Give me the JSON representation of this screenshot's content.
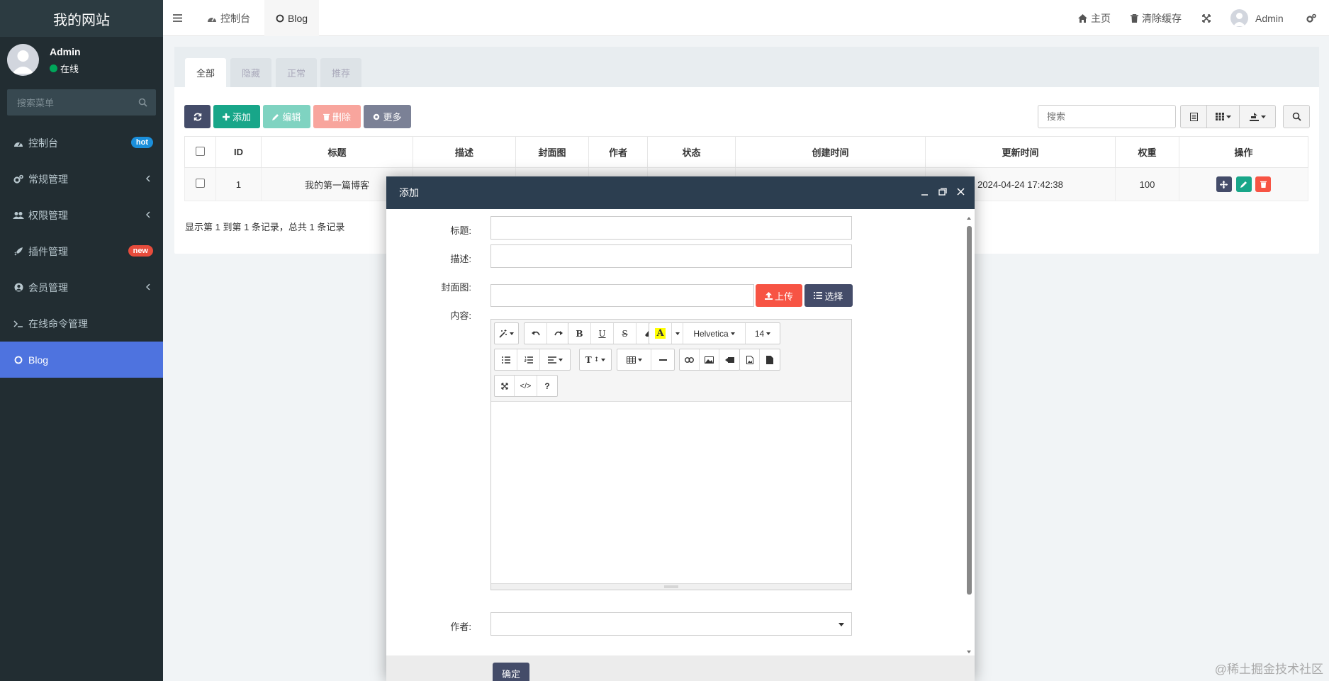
{
  "sidebar": {
    "logo": "我的网站",
    "user": {
      "name": "Admin",
      "status": "在线"
    },
    "search_placeholder": "搜索菜单",
    "items": [
      {
        "label": "控制台",
        "badge": "hot",
        "badge_color": "#1b8fdb",
        "icon": "dashboard-icon"
      },
      {
        "label": "常规管理",
        "icon": "cogs-icon",
        "has_children": true
      },
      {
        "label": "权限管理",
        "icon": "users-icon",
        "has_children": true
      },
      {
        "label": "插件管理",
        "badge": "new",
        "badge_color": "#e74c3c",
        "icon": "rocket-icon"
      },
      {
        "label": "会员管理",
        "icon": "user-circle-icon",
        "has_children": true
      },
      {
        "label": "在线命令管理",
        "icon": "terminal-icon"
      },
      {
        "label": "Blog",
        "icon": "circle-o-icon",
        "active": true
      }
    ]
  },
  "header": {
    "tabs": [
      {
        "label": "控制台",
        "icon": "dashboard-icon"
      },
      {
        "label": "Blog",
        "icon": "circle-o-icon",
        "active": true
      }
    ],
    "home_label": "主页",
    "clear_cache_label": "清除缓存",
    "user_name": "Admin"
  },
  "content": {
    "filter_tabs": [
      "全部",
      "隐藏",
      "正常",
      "推荐"
    ],
    "toolbar": {
      "add": "添加",
      "edit": "编辑",
      "delete": "删除",
      "more": "更多",
      "search_placeholder": "搜索"
    },
    "table": {
      "columns": [
        "ID",
        "标题",
        "描述",
        "封面图",
        "作者",
        "状态",
        "创建时间",
        "更新时间",
        "权重",
        "操作"
      ],
      "rows": [
        {
          "id": "1",
          "title": "我的第一篇博客",
          "updated": "2024-04-24 17:42:38",
          "weight": "100"
        }
      ]
    },
    "page_info": "显示第 1 到第 1 条记录，总共 1 条记录"
  },
  "modal": {
    "title": "添加",
    "fields": {
      "title_label": "标题:",
      "desc_label": "描述:",
      "cover_label": "封面图:",
      "content_label": "内容:",
      "author_label": "作者:"
    },
    "upload_label": "上传",
    "choose_label": "选择",
    "editor": {
      "font": "Helvetica",
      "size": "14"
    },
    "confirm_label": "确定"
  },
  "colors": {
    "sidebar_bg": "#222d32",
    "active": "#4e73df",
    "add_btn": "#18a689",
    "delete_btn": "#f75444",
    "dark_btn": "#444c69",
    "modal_header": "#2c3e50"
  },
  "watermark": "@稀土掘金技术社区"
}
